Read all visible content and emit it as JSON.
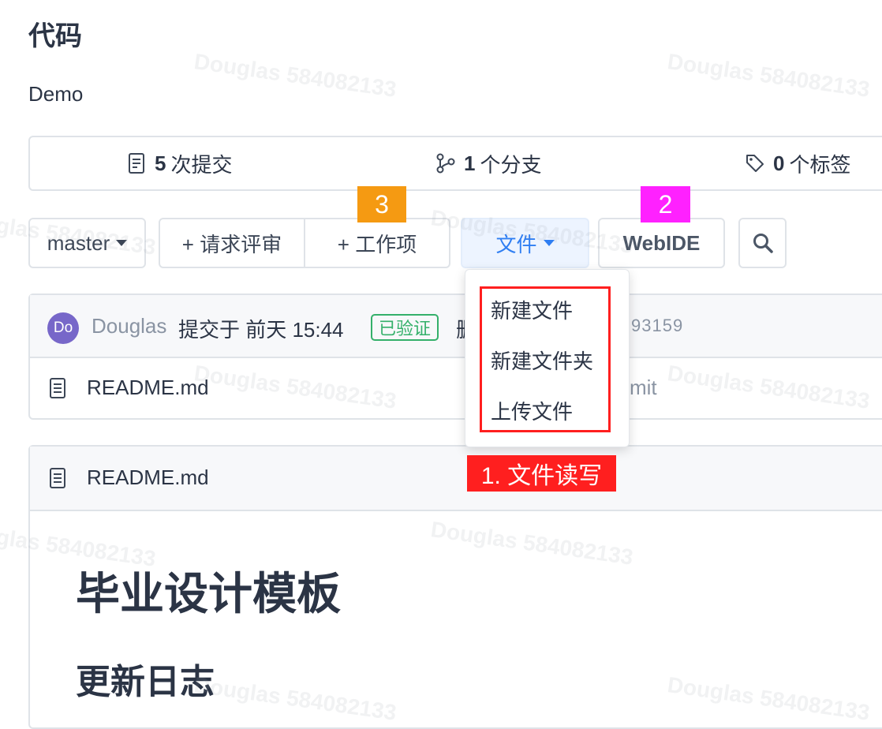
{
  "page": {
    "title": "代码",
    "description": "Demo"
  },
  "stats": {
    "commits": {
      "count": "5",
      "label": "次提交"
    },
    "branches": {
      "count": "1",
      "label": "个分支"
    },
    "tags": {
      "count": "0",
      "label": "个标签"
    }
  },
  "toolbar": {
    "branch": "master",
    "request_review": "+ 请求评审",
    "work_item": "+ 工作项",
    "file": "文件",
    "webide": "WebIDE"
  },
  "file_menu": {
    "items": [
      "新建文件",
      "新建文件夹",
      "上传文件"
    ]
  },
  "annotations": {
    "m1": "1. 文件读写",
    "m2": "2",
    "m3": "3"
  },
  "commit": {
    "avatar": "Do",
    "author": "Douglas",
    "time": "提交于 前天 15:44",
    "verified": "已验证",
    "message": "删",
    "hash": "93159"
  },
  "files": [
    {
      "name": "README.md",
      "message": "mit"
    }
  ],
  "readme": {
    "filename": "README.md",
    "h1": "毕业设计模板",
    "h2": "更新日志"
  },
  "watermark": "Douglas 584082133",
  "colors": {
    "accent": "#2f7ef2",
    "verified": "#34b06a",
    "annotation_red": "#ff1f1f",
    "annotation_orange": "#f59a12",
    "annotation_magenta": "#ff21ff"
  }
}
